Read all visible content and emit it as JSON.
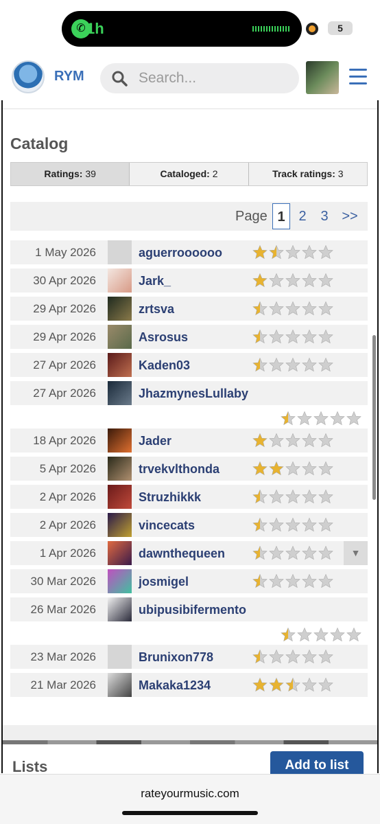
{
  "status_bar": {
    "call_time": "1h",
    "battery": "5"
  },
  "nav": {
    "brand": "RYM",
    "search_placeholder": "Search..."
  },
  "catalog": {
    "title": "Catalog",
    "tabs": [
      {
        "label": "Ratings:",
        "count": "39"
      },
      {
        "label": "Cataloged:",
        "count": "2"
      },
      {
        "label": "Track ratings:",
        "count": "3"
      }
    ],
    "pager": {
      "label": "Page",
      "pages": [
        "1",
        "2",
        "3"
      ],
      "next": ">>"
    }
  },
  "ratings": [
    {
      "date": "1 May 2026",
      "user": "aguerroooooo",
      "stars": 1.5
    },
    {
      "date": "30 Apr 2026",
      "user": "Jark_",
      "stars": 1
    },
    {
      "date": "29 Apr 2026",
      "user": "zrtsva",
      "stars": 0.5
    },
    {
      "date": "29 Apr 2026",
      "user": "Asrosus",
      "stars": 0.5
    },
    {
      "date": "27 Apr 2026",
      "user": "Kaden03",
      "stars": 0.5
    },
    {
      "date": "27 Apr 2026",
      "user": "JhazmynesLullaby",
      "stars": 0.5,
      "wrapped": true
    },
    {
      "date": "18 Apr 2026",
      "user": "Jader",
      "stars": 1
    },
    {
      "date": "5 Apr 2026",
      "user": "trvekvlthonda",
      "stars": 2
    },
    {
      "date": "2 Apr 2026",
      "user": "Struzhikkk",
      "stars": 0.5
    },
    {
      "date": "2 Apr 2026",
      "user": "vincecats",
      "stars": 0.5
    },
    {
      "date": "1 Apr 2026",
      "user": "dawnthequeen",
      "stars": 0.5,
      "dropdown": true
    },
    {
      "date": "30 Mar 2026",
      "user": "josmigel",
      "stars": 0.5
    },
    {
      "date": "26 Mar 2026",
      "user": "ubipusibifermento",
      "stars": 0.5,
      "wrapped": true
    },
    {
      "date": "23 Mar 2026",
      "user": "Brunixon778",
      "stars": 0.5
    },
    {
      "date": "21 Mar 2026",
      "user": "Makaka1234",
      "stars": 2.5
    }
  ],
  "lists": {
    "title": "Lists",
    "add_button": "Add to list"
  },
  "browser": {
    "url": "rateyourmusic.com"
  },
  "colors": {
    "accent": "#3a6fb8",
    "username": "#2b3f73",
    "button": "#25589c",
    "star_gold": "#e8b330",
    "star_gray": "#cfcfcf"
  },
  "icons": {
    "search": "search-icon",
    "menu": "hamburger-menu-icon",
    "dropdown": "caret-down-icon",
    "star": "star-icon"
  }
}
